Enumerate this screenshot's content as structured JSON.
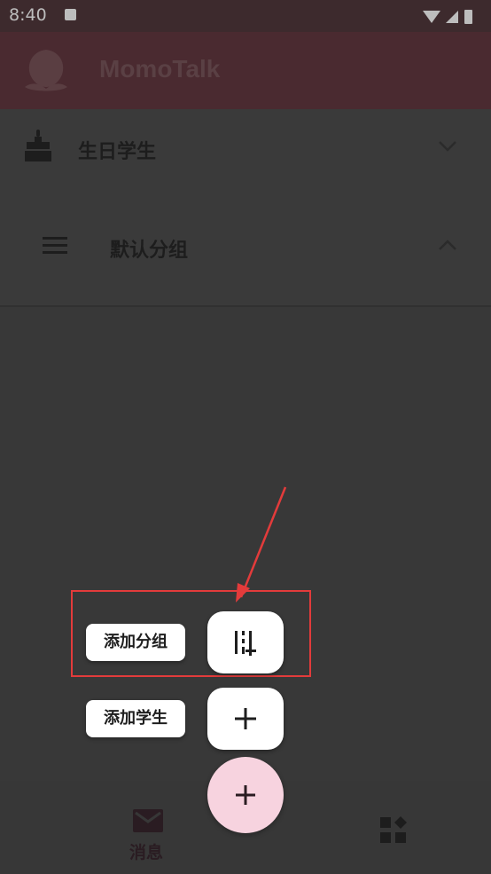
{
  "status_bar": {
    "time": "8:40"
  },
  "app_bar": {
    "title": "MomoTalk"
  },
  "groups": [
    {
      "label": "生日学生",
      "icon": "cake-icon",
      "expand_icon": "chevron-down-icon"
    },
    {
      "label": "默认分组",
      "icon": "menu-icon",
      "expand_icon": "chevron-up-icon"
    }
  ],
  "fab_menu": {
    "add_group_label": "添加分组",
    "add_student_label": "添加学生",
    "main_icon": "plus-icon"
  },
  "bottom_nav": {
    "messages_label": "消息",
    "messages_icon": "mail-icon",
    "other_icon": "widgets-icon"
  },
  "colors": {
    "accent": "#f7d3df",
    "appbar": "#4a2a30",
    "annotation": "#e33b3b"
  }
}
